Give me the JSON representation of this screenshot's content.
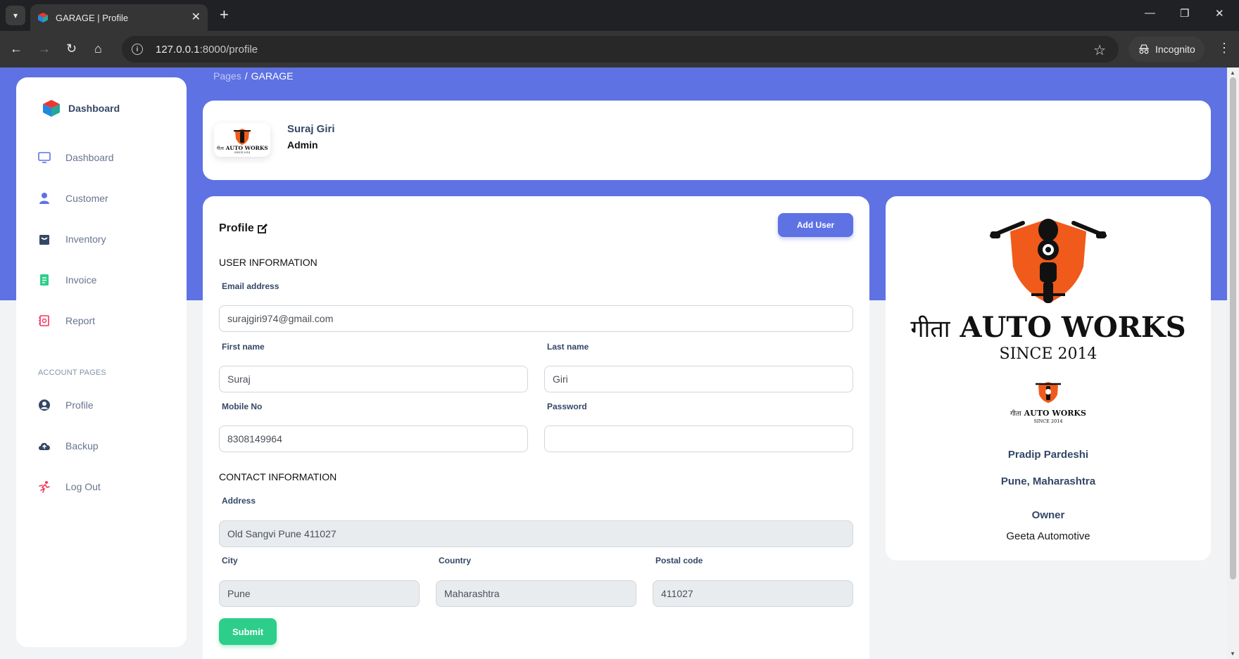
{
  "browser": {
    "tab_title": "GARAGE | Profile",
    "url_host": "127.0.0.1",
    "url_path": ":8000/profile",
    "incognito_label": "Incognito"
  },
  "sidebar": {
    "brand": "Dashboard",
    "items": [
      {
        "label": "Dashboard",
        "icon": "monitor-icon"
      },
      {
        "label": "Customer",
        "icon": "user-icon"
      },
      {
        "label": "Inventory",
        "icon": "box-icon"
      },
      {
        "label": "Invoice",
        "icon": "document-icon"
      },
      {
        "label": "Report",
        "icon": "report-icon"
      }
    ],
    "section_title": "ACCOUNT PAGES",
    "account_items": [
      {
        "label": "Profile",
        "icon": "user-circle-icon"
      },
      {
        "label": "Backup",
        "icon": "cloud-upload-icon"
      },
      {
        "label": "Log Out",
        "icon": "running-man-icon"
      }
    ]
  },
  "breadcrumb": {
    "parent": "Pages",
    "sep": "/",
    "current": "GARAGE"
  },
  "header": {
    "name": "Suraj Giri",
    "role": "Admin"
  },
  "profile_form": {
    "title": "Profile",
    "add_user_label": "Add User",
    "user_info_title": "USER INFORMATION",
    "email_label": "Email address",
    "email_value": "surajgiri974@gmail.com",
    "first_name_label": "First name",
    "first_name_value": "Suraj",
    "last_name_label": "Last name",
    "last_name_value": "Giri",
    "mobile_label": "Mobile No",
    "mobile_value": "8308149964",
    "password_label": "Password",
    "password_value": "",
    "contact_info_title": "CONTACT INFORMATION",
    "address_label": "Address",
    "address_value": "Old Sangvi Pune 411027",
    "city_label": "City",
    "city_value": "Pune",
    "country_label": "Country",
    "country_value": "Maharashtra",
    "postal_label": "Postal code",
    "postal_value": "411027",
    "submit_label": "Submit"
  },
  "info_card": {
    "logo_hindi": "गीता",
    "logo_main": "AUTO WORKS",
    "logo_since": "SINCE 2014",
    "small_logo_main": "AUTO WORKS",
    "small_logo_since": "SINCE 2014",
    "owner_name": "Pradip Pardeshi",
    "location": "Pune, Maharashtra",
    "role_title": "Owner",
    "company": "Geeta Automotive"
  },
  "colors": {
    "primary": "#5e72e4",
    "success": "#2dce89",
    "logo_orange": "#f05a1a"
  }
}
